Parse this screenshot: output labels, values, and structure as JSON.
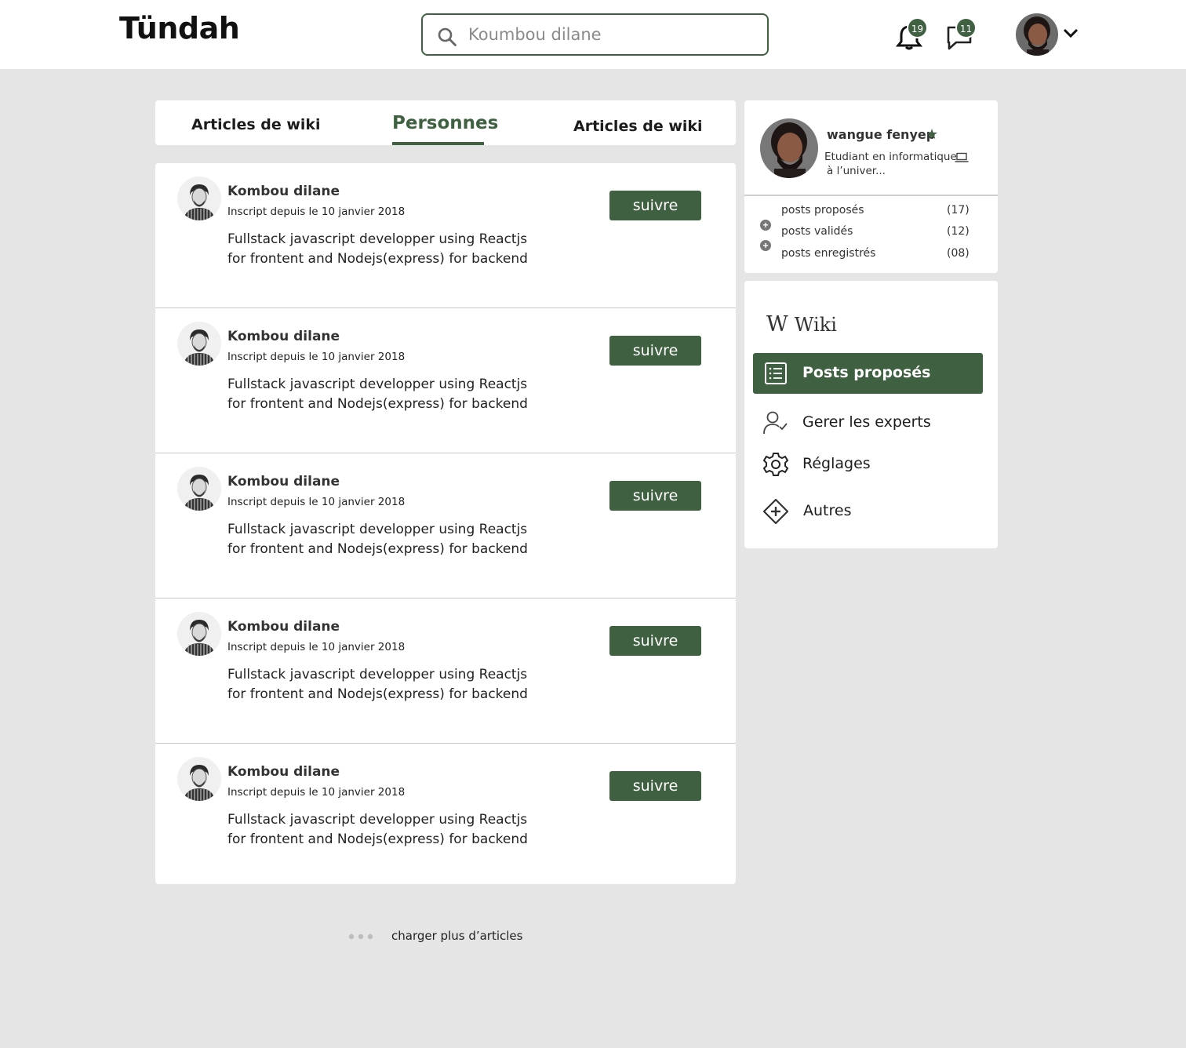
{
  "header": {
    "logo": "Tündah",
    "search": {
      "value": "",
      "placeholder": "Koumbou dilane"
    },
    "notifications_count": "19",
    "messages_count": "11"
  },
  "tabs": [
    {
      "label": "Articles de wiki"
    },
    {
      "label": "Personnes",
      "active": true
    },
    {
      "label": "Articles de wiki"
    }
  ],
  "people": [
    {
      "name": "Kombou dilane",
      "since": "Inscript  depuis le 10 janvier 2018",
      "desc_line1": "Fullstack  javascript developper using Reactjs",
      "desc_line2": "for frontent and Nodejs(express) for backend",
      "follow_label": "suivre"
    },
    {
      "name": "Kombou dilane",
      "since": "Inscript  depuis le 10 janvier 2018",
      "desc_line1": "Fullstack  javascript developper using Reactjs",
      "desc_line2": "for frontent and Nodejs(express) for backend",
      "follow_label": "suivre"
    },
    {
      "name": "Kombou dilane",
      "since": "Inscript  depuis le 10 janvier 2018",
      "desc_line1": "Fullstack  javascript developper using Reactjs",
      "desc_line2": "for frontent and Nodejs(express) for backend",
      "follow_label": "suivre"
    },
    {
      "name": "Kombou dilane",
      "since": "Inscript  depuis le 10 janvier 2018",
      "desc_line1": "Fullstack  javascript developper using Reactjs",
      "desc_line2": "for frontent and Nodejs(express) for backend",
      "follow_label": "suivre"
    },
    {
      "name": "Kombou dilane",
      "since": "Inscript  depuis le 10 janvier 2018",
      "desc_line1": "Fullstack  javascript developper using Reactjs",
      "desc_line2": "for frontent and Nodejs(express) for backend",
      "follow_label": "suivre"
    }
  ],
  "load_more": "charger plus d’articles",
  "profile": {
    "name": "wangue fenyep",
    "bio_line1": "Etudiant en informatique",
    "bio_line2": "à l’univer...",
    "stats": [
      {
        "label": "posts proposés",
        "count": "(17)"
      },
      {
        "label": "posts validés",
        "count": "(12)"
      },
      {
        "label": "posts enregistrés",
        "count": "(08)"
      }
    ]
  },
  "sidebar_nav": {
    "title": "Wiki",
    "items": [
      {
        "label": "Posts proposés",
        "icon": "list-icon",
        "active": true
      },
      {
        "label": "Gerer les experts",
        "icon": "user-check-icon"
      },
      {
        "label": "Réglages",
        "icon": "gear-icon"
      },
      {
        "label": "Autres",
        "icon": "diamond-plus-icon"
      }
    ]
  },
  "colors": {
    "accent": "#3f6041",
    "background": "#e5e5e5",
    "card": "#ffffff"
  }
}
